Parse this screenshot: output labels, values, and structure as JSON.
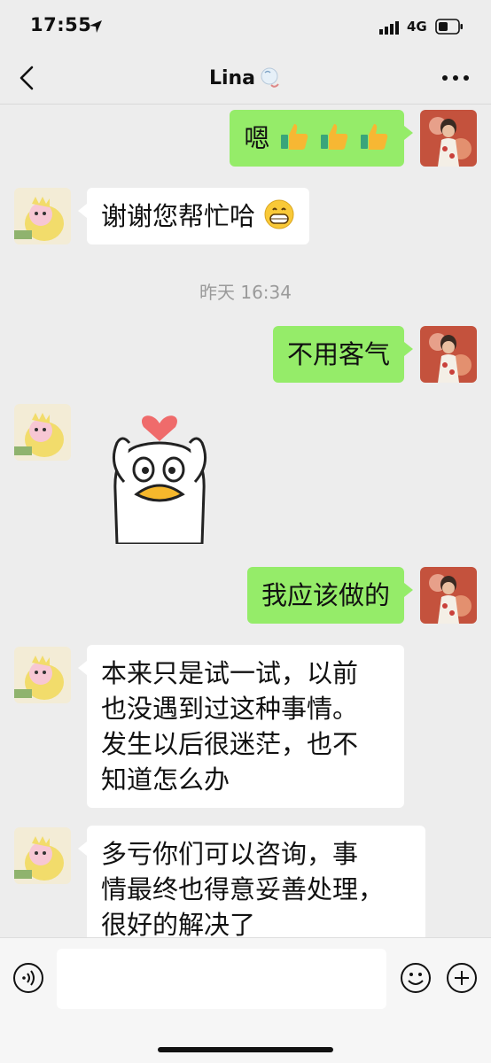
{
  "status_bar": {
    "time": "17:55",
    "network": "4G"
  },
  "nav": {
    "title": "Lina"
  },
  "messages": [
    {
      "side": "right",
      "text": "嗯",
      "emoji": [
        "thumbs-up",
        "thumbs-up",
        "thumbs-up"
      ]
    },
    {
      "side": "left",
      "text": "谢谢您帮忙哈",
      "emoji": [
        "grinning-face"
      ]
    },
    {
      "type": "timestamp",
      "text": "昨天 16:34"
    },
    {
      "side": "right",
      "text": "不用客气"
    },
    {
      "side": "left",
      "type": "sticker",
      "sticker": "duck-heart-sticker"
    },
    {
      "side": "right",
      "text": "我应该做的"
    },
    {
      "side": "left",
      "lines": [
        "本来只是试一试，以前",
        "也没遇到过这种事情。",
        "发生以后很迷茫，也不",
        "知道怎么办"
      ]
    },
    {
      "side": "left",
      "lines": [
        "多亏你们可以咨询，事",
        "情最终也得意妥善处理，",
        "很好的解决了"
      ]
    }
  ],
  "input": {
    "placeholder": ""
  },
  "colors": {
    "background": "#ededed",
    "sent_bubble": "#95ec69",
    "received_bubble": "#ffffff"
  }
}
